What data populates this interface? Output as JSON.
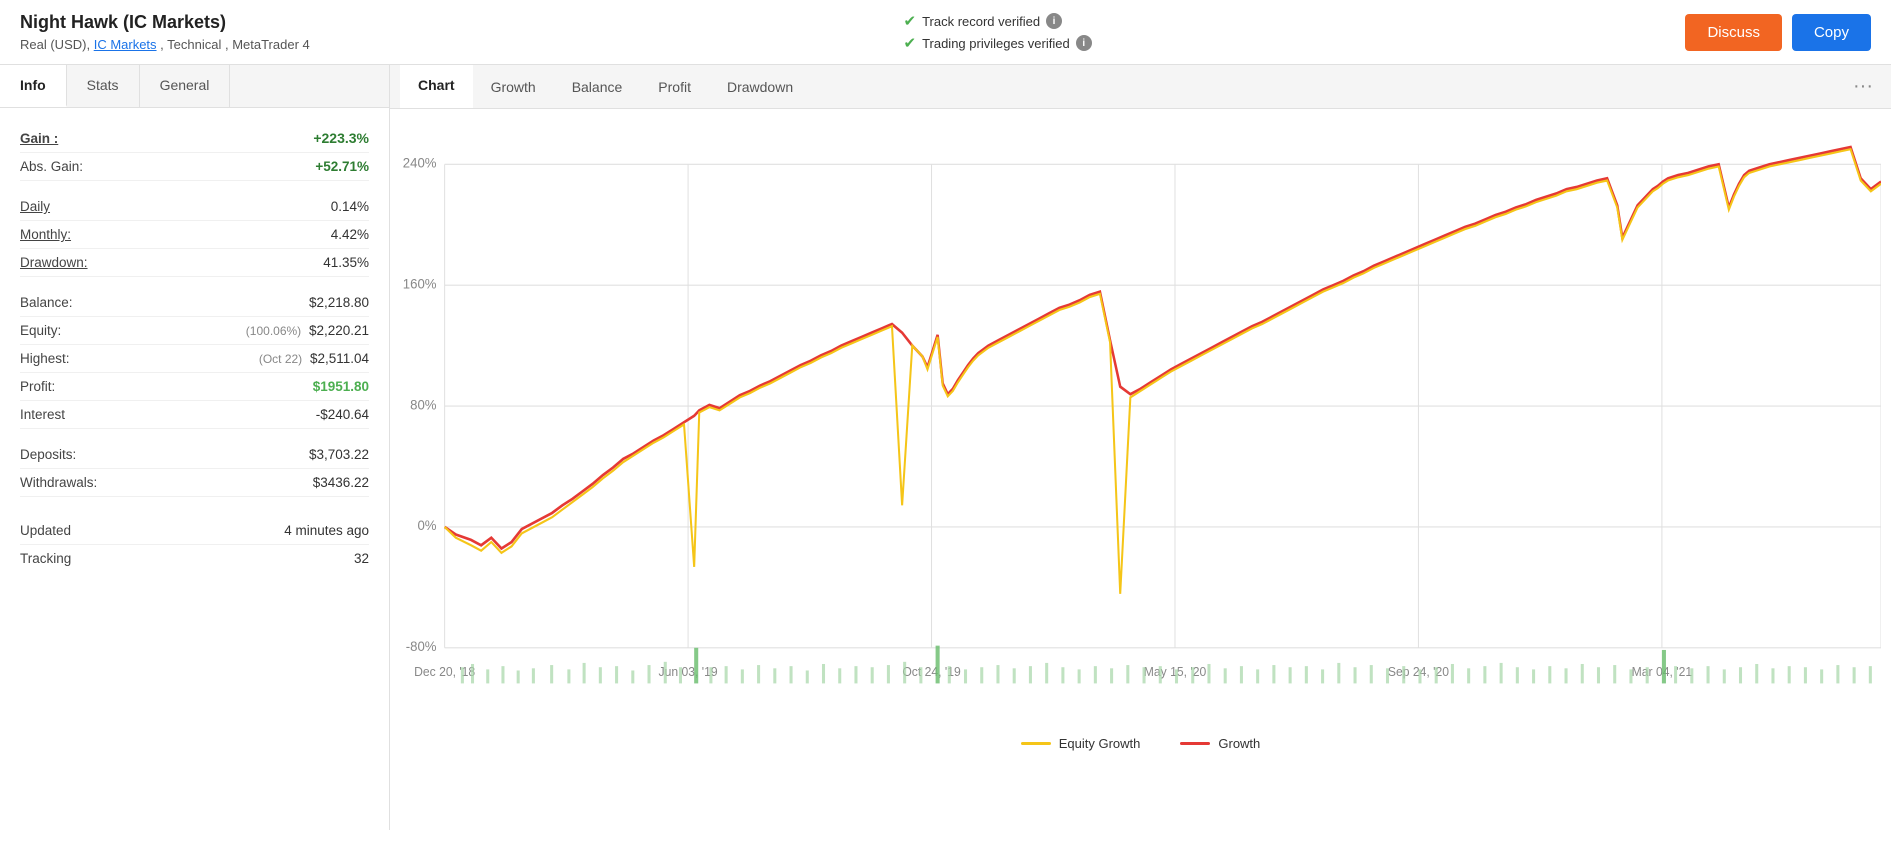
{
  "header": {
    "title": "Night Hawk (IC Markets)",
    "subtitle": "Real (USD),",
    "subtitle_link": "IC Markets",
    "subtitle_rest": ", Technical , MetaTrader 4",
    "verify1": "Track record verified",
    "verify2": "Trading privileges verified",
    "btn_discuss": "Discuss",
    "btn_copy": "Copy"
  },
  "left_tabs": [
    {
      "label": "Info",
      "active": true
    },
    {
      "label": "Stats",
      "active": false
    },
    {
      "label": "General",
      "active": false
    }
  ],
  "stats": {
    "gain_label": "Gain :",
    "gain_value": "+223.3%",
    "abs_gain_label": "Abs. Gain:",
    "abs_gain_value": "+52.71%",
    "daily_label": "Daily",
    "daily_value": "0.14%",
    "monthly_label": "Monthly:",
    "monthly_value": "4.42%",
    "drawdown_label": "Drawdown:",
    "drawdown_value": "41.35%",
    "balance_label": "Balance:",
    "balance_value": "$2,218.80",
    "equity_label": "Equity:",
    "equity_secondary": "(100.06%)",
    "equity_value": "$2,220.21",
    "highest_label": "Highest:",
    "highest_secondary": "(Oct 22)",
    "highest_value": "$2,511.04",
    "profit_label": "Profit:",
    "profit_value": "$1951.80",
    "interest_label": "Interest",
    "interest_value": "-$240.64",
    "deposits_label": "Deposits:",
    "deposits_value": "$3,703.22",
    "withdrawals_label": "Withdrawals:",
    "withdrawals_value": "$3436.22",
    "updated_label": "Updated",
    "updated_value": "4 minutes ago",
    "tracking_label": "Tracking",
    "tracking_value": "32"
  },
  "chart_tabs": [
    {
      "label": "Chart",
      "active": true
    },
    {
      "label": "Growth",
      "active": false
    },
    {
      "label": "Balance",
      "active": false
    },
    {
      "label": "Profit",
      "active": false
    },
    {
      "label": "Drawdown",
      "active": false
    }
  ],
  "chart": {
    "y_labels": [
      "240%",
      "160%",
      "80%",
      "0%",
      "-80%"
    ],
    "x_labels": [
      "Dec 20, '18",
      "Jun 03, '19",
      "Oct 24, '19",
      "May 15, '20",
      "Sep 24, '20",
      "Mar 04, '21"
    ],
    "more_icon": "···"
  },
  "legend": {
    "equity_growth_label": "Equity Growth",
    "equity_growth_color": "#f5c518",
    "growth_label": "Growth",
    "growth_color": "#e53935"
  }
}
